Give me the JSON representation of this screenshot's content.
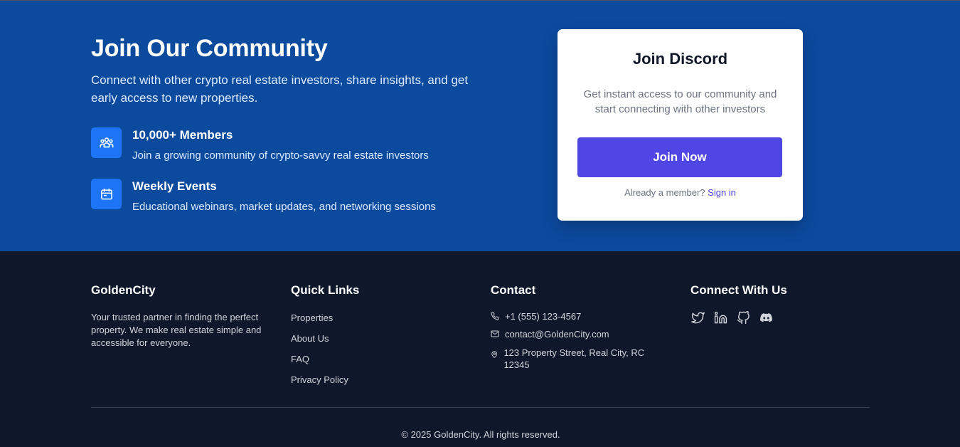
{
  "community": {
    "title": "Join Our Community",
    "description": "Connect with other crypto real estate investors, share insights, and get early access to new properties.",
    "features": [
      {
        "icon": "users-icon",
        "title": "10,000+ Members",
        "text": "Join a growing community of crypto-savvy real estate investors"
      },
      {
        "icon": "calendar-icon",
        "title": "Weekly Events",
        "text": "Educational webinars, market updates, and networking sessions"
      }
    ]
  },
  "discord": {
    "title": "Join Discord",
    "description": "Get instant access to our community and start connecting with other investors",
    "button_label": "Join Now",
    "member_prompt": "Already a member?",
    "signin_label": "Sign in"
  },
  "footer": {
    "brand": {
      "title": "GoldenCity",
      "description": "Your trusted partner in finding the perfect property. We make real estate simple and accessible for everyone."
    },
    "quick_links": {
      "title": "Quick Links",
      "items": [
        "Properties",
        "About Us",
        "FAQ",
        "Privacy Policy"
      ]
    },
    "contact": {
      "title": "Contact",
      "phone": "+1 (555) 123-4567",
      "email": "contact@GoldenCity.com",
      "address": "123 Property Street, Real City, RC 12345"
    },
    "social": {
      "title": "Connect With Us",
      "icons": [
        "twitter-icon",
        "linkedin-icon",
        "github-icon",
        "discord-icon"
      ]
    },
    "copyright": "© 2025 GoldenCity. All rights reserved."
  },
  "colors": {
    "community_bg": "#0c4a9e",
    "footer_bg": "#0f172a",
    "accent": "#4f46e5",
    "feature_icon_bg": "#1d75f5"
  }
}
